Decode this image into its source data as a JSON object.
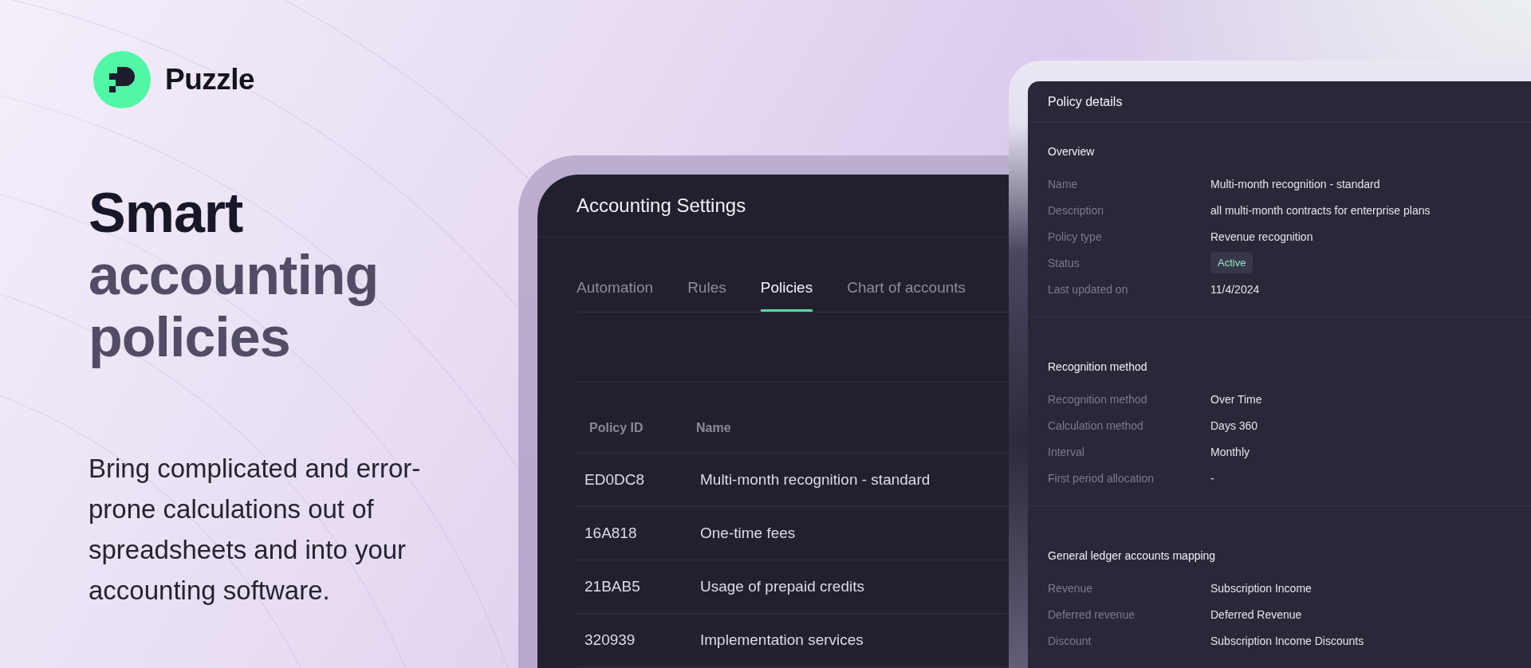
{
  "brand": {
    "name": "Puzzle"
  },
  "headline": [
    {
      "text": "Smart",
      "kind": "strong"
    },
    {
      "text": "accounting",
      "kind": "soft"
    },
    {
      "text": "policies",
      "kind": "soft"
    }
  ],
  "description": "Bring complicated and error-prone calculations out of spreadsheets and into your accounting software.",
  "settings_window": {
    "title": "Accounting Settings",
    "tabs": [
      {
        "label": "Automation",
        "selected": false
      },
      {
        "label": "Rules",
        "selected": false
      },
      {
        "label": "Policies",
        "selected": true
      },
      {
        "label": "Chart of accounts",
        "selected": false
      }
    ],
    "table": {
      "columns": [
        "Policy ID",
        "Name"
      ],
      "rows": [
        [
          "ED0DC8",
          "Multi-month recognition - standard"
        ],
        [
          "16A818",
          "One-time fees"
        ],
        [
          "21BAB5",
          "Usage of prepaid credits"
        ],
        [
          "320939",
          "Implementation services"
        ]
      ]
    }
  },
  "details_panel": {
    "title": "Policy details",
    "sections": [
      {
        "title": "Overview",
        "fields": [
          {
            "label": "Name",
            "value": "Multi-month recognition - standard",
            "kind": "text"
          },
          {
            "label": "Description",
            "value": "all multi-month contracts for enterprise plans",
            "kind": "text"
          },
          {
            "label": "Policy type",
            "value": "Revenue recognition",
            "kind": "text"
          },
          {
            "label": "Status",
            "value": "Active",
            "kind": "badge"
          },
          {
            "label": "Last updated on",
            "value": "11/4/2024",
            "kind": "text"
          }
        ]
      },
      {
        "title": "Recognition method",
        "fields": [
          {
            "label": "Recognition method",
            "value": "Over Time",
            "kind": "text"
          },
          {
            "label": "Calculation method",
            "value": "Days 360",
            "kind": "text"
          },
          {
            "label": "Interval",
            "value": "Monthly",
            "kind": "text"
          },
          {
            "label": "First period allocation",
            "value": "-",
            "kind": "text"
          }
        ]
      },
      {
        "title": "General ledger accounts mapping",
        "fields": [
          {
            "label": "Revenue",
            "value": "Subscription Income",
            "kind": "text"
          },
          {
            "label": "Deferred revenue",
            "value": "Deferred Revenue",
            "kind": "text"
          },
          {
            "label": "Discount",
            "value": "Subscription Income Discounts",
            "kind": "text"
          }
        ]
      }
    ]
  }
}
